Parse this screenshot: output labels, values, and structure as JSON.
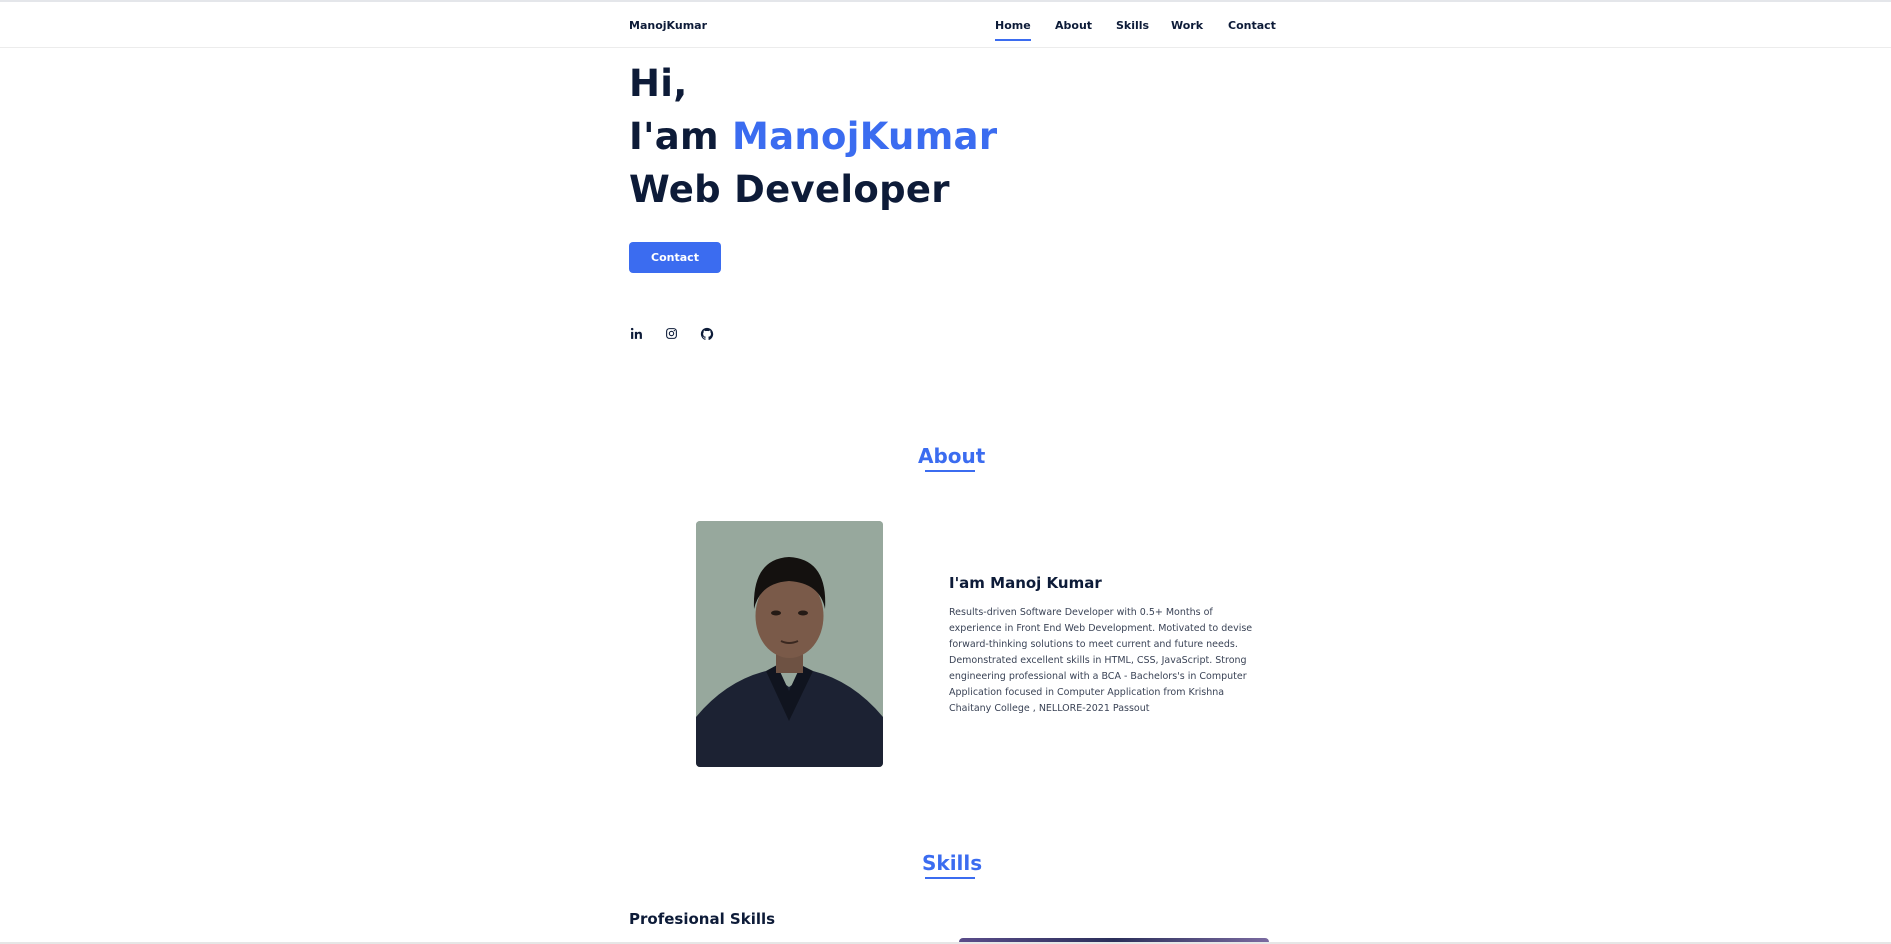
{
  "header": {
    "logo": "ManojKumar",
    "nav": [
      {
        "label": "Home",
        "active": true
      },
      {
        "label": "About",
        "active": false
      },
      {
        "label": "Skills",
        "active": false
      },
      {
        "label": "Work",
        "active": false
      },
      {
        "label": "Contact",
        "active": false
      }
    ]
  },
  "hero": {
    "greeting": "Hi,",
    "intro_prefix": "I'am ",
    "name": "ManojKumar",
    "role": "Web Developer",
    "contact_button": "Contact",
    "social_icons": [
      "linkedin-icon",
      "instagram-icon",
      "github-icon"
    ]
  },
  "about": {
    "title": "About",
    "subtitle": "I'am Manoj Kumar",
    "description": "Results-driven Software Developer with 0.5+ Months of experience in Front End Web Development. Motivated to devise forward-thinking solutions to meet current and future needs. Demonstrated excellent skills in HTML, CSS, JavaScript. Strong engineering professional with a BCA - Bachelors's in Computer Application focused in Computer Application from Krishna Chaitany College , NELLORE-2021 Passout"
  },
  "skills": {
    "title": "Skills",
    "subtitle": "Profesional Skills"
  },
  "colors": {
    "accent": "#3b6cf0",
    "text": "#0d1b38"
  }
}
